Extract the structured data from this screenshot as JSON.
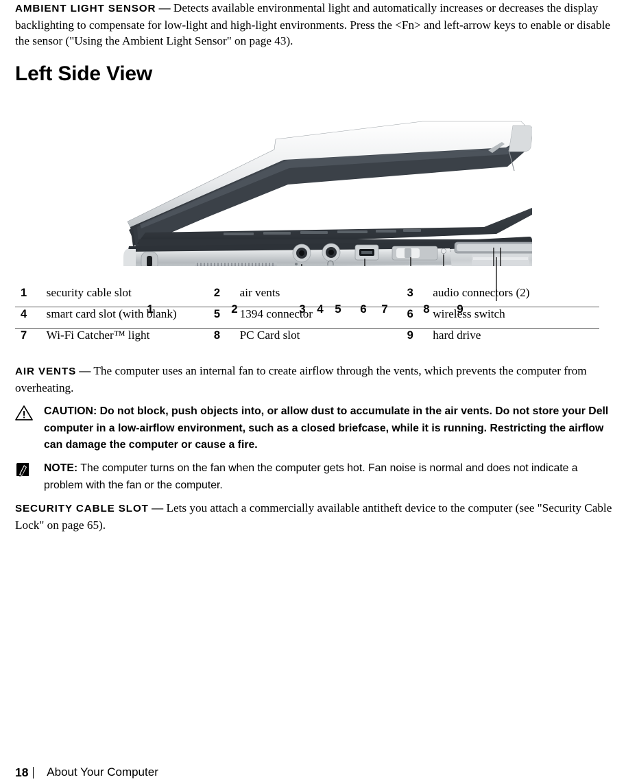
{
  "document": {
    "intro": {
      "term": "AMBIENT LIGHT SENSOR",
      "dash": "—",
      "text": "Detects available environmental light and automatically increases or decreases the display backlighting to compensate for low-light and high-light environments. Press the <Fn> and left-arrow keys to enable or disable the sensor (\"Using the Ambient Light Sensor\" on page 43)."
    },
    "heading": "Left Side View",
    "figure": {
      "alt_name": "laptop-left-side-view",
      "callouts": [
        "1",
        "2",
        "3",
        "4",
        "5",
        "6",
        "7",
        "8",
        "9"
      ]
    },
    "legend": {
      "rows": [
        [
          {
            "num": "1",
            "label": "security cable slot"
          },
          {
            "num": "2",
            "label": "air vents"
          },
          {
            "num": "3",
            "label": "audio connectors (2)"
          }
        ],
        [
          {
            "num": "4",
            "label": "smart card slot (with blank)"
          },
          {
            "num": "5",
            "label": "1394 connector"
          },
          {
            "num": "6",
            "label": "wireless switch"
          }
        ],
        [
          {
            "num": "7",
            "label": "Wi-Fi Catcher™ light"
          },
          {
            "num": "8",
            "label": "PC Card slot"
          },
          {
            "num": "9",
            "label": "hard drive"
          }
        ]
      ]
    },
    "air_vents": {
      "term": "AIR VENTS",
      "dash": "—",
      "text": "The computer uses an internal fan to create airflow through the vents, which prevents the computer from overheating."
    },
    "caution": {
      "icon": "warning-triangle-icon",
      "label": "CAUTION:",
      "text": "Do not block, push objects into, or allow dust to accumulate in the air vents. Do not store your Dell computer in a low-airflow environment, such as a closed briefcase, while it is running. Restricting the airflow can damage the computer or cause a fire."
    },
    "note": {
      "icon": "note-pencil-icon",
      "label": "NOTE:",
      "text": "The computer turns on the fan when the computer gets hot. Fan noise is normal and does not indicate a problem with the fan or the computer."
    },
    "security_cable_slot": {
      "term": "SECURITY CABLE SLOT",
      "dash": "—",
      "text": "Lets you attach a commercially available antitheft device to the computer (see \"Security Cable Lock\" on page 65)."
    },
    "footer": {
      "page_number": "18",
      "title": "About Your Computer"
    },
    "colors": {
      "rule": "#5a5a5a",
      "text": "#000000",
      "lid_dark": "#3b4148",
      "body_light": "#c9ccce",
      "body_mid": "#9aa0a5"
    }
  }
}
